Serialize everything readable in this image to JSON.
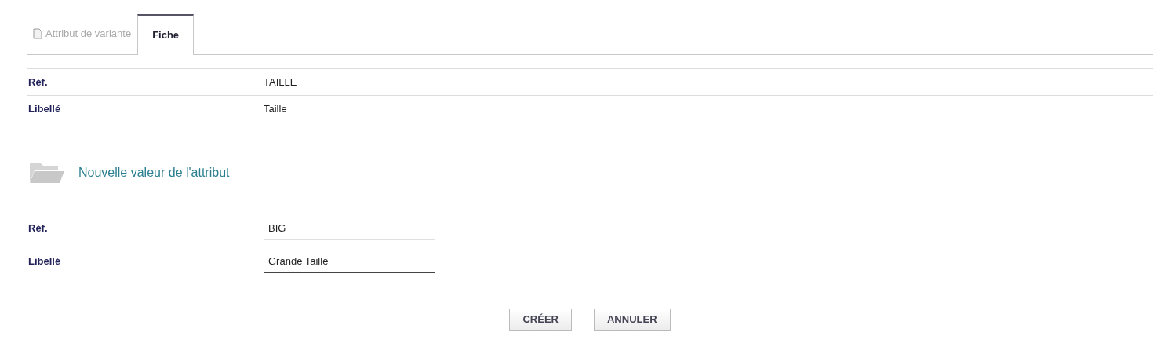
{
  "tabs": [
    {
      "label": "Attribut de variante",
      "selected": false
    },
    {
      "label": "Fiche",
      "selected": true
    }
  ],
  "details": [
    {
      "label": "Réf.",
      "value": "TAILLE"
    },
    {
      "label": "Libellé",
      "value": "Taille"
    }
  ],
  "section": {
    "title": "Nouvelle valeur de l'attribut"
  },
  "form": [
    {
      "label": "Réf.",
      "value": "BIG",
      "focused": false
    },
    {
      "label": "Libellé",
      "value": "Grande Taille",
      "focused": true
    }
  ],
  "buttons": [
    "CRÉER",
    "ANNULER"
  ]
}
